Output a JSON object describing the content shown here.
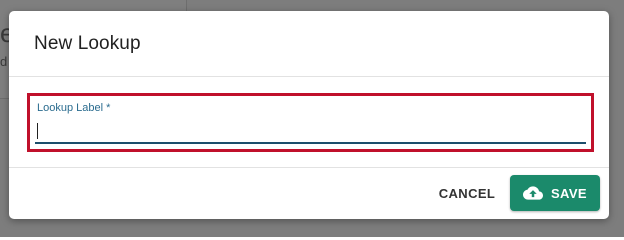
{
  "background": {
    "fragment_large": "e",
    "fragment_small": "d"
  },
  "dialog": {
    "title": "New Lookup",
    "field": {
      "label": "Lookup Label *",
      "value": "",
      "placeholder": ""
    },
    "actions": {
      "cancel_label": "CANCEL",
      "save_label": "SAVE",
      "save_icon": "cloud-upload-icon"
    }
  },
  "colors": {
    "primary": "#1b8a6b",
    "focus_highlight": "#c0102b",
    "field_label": "#2b6c8f",
    "field_underline": "#1c4e6b"
  }
}
